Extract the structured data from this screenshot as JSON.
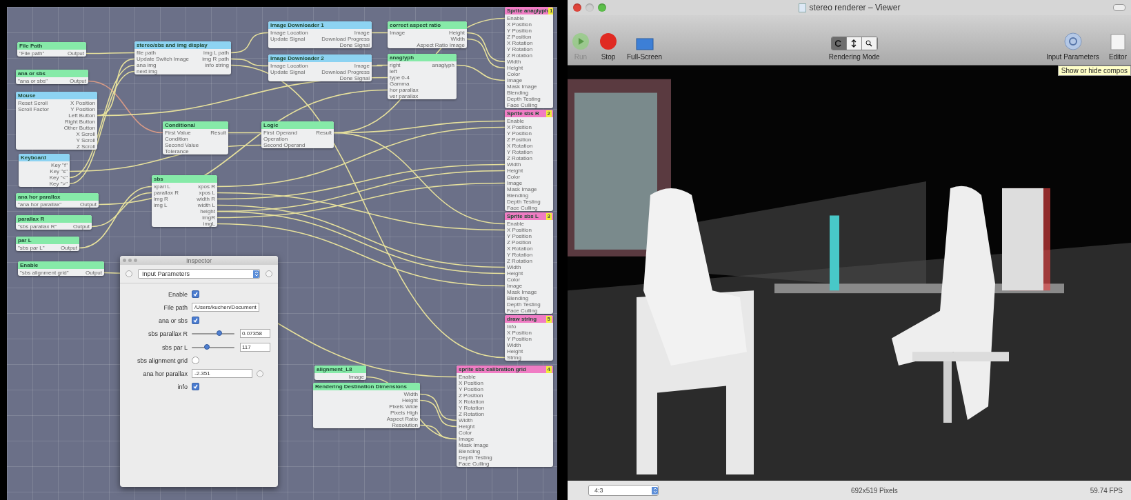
{
  "editor": {
    "nodes": [
      {
        "title": "File Path",
        "kind": "processor",
        "inputs": [
          "\"File path\""
        ],
        "outputs": [
          "Output"
        ]
      },
      {
        "title": "ana or sbs",
        "kind": "processor",
        "inputs": [
          "\"ana or sbs\""
        ],
        "outputs": [
          "Output"
        ]
      },
      {
        "title": "Mouse",
        "kind": "provider",
        "inputs": [
          "Reset Scroll",
          "Scroll Factor"
        ],
        "outputs": [
          "X Position",
          "Y Position",
          "Left Button",
          "Right Button",
          "Other Button",
          "X Scroll",
          "Y Scroll",
          "Z Scroll"
        ]
      },
      {
        "title": "Keyboard",
        "kind": "provider",
        "outputs": [
          "Key \"f\"",
          "Key \"s\"",
          "Key \"<\"",
          "Key \">\""
        ]
      },
      {
        "title": "ana hor parallax",
        "kind": "processor",
        "inputs": [
          "\"ana hor parallax\""
        ],
        "outputs": [
          "Output"
        ]
      },
      {
        "title": "parallax R",
        "kind": "processor",
        "inputs": [
          "\"sbs parallax R\""
        ],
        "outputs": [
          "Output"
        ]
      },
      {
        "title": "par L",
        "kind": "processor",
        "inputs": [
          "\"sbs par L\""
        ],
        "outputs": [
          "Output"
        ]
      },
      {
        "title": "Enable",
        "kind": "processor",
        "inputs": [
          "\"sbs alignment grid\""
        ],
        "outputs": [
          "Output"
        ]
      },
      {
        "title": "stereo/sbs and img display",
        "kind": "provider",
        "inputs": [
          "file path",
          "Update Switch Image",
          "ana img",
          "next img"
        ],
        "outputs": [
          "img L path",
          "img R path",
          "info string"
        ]
      },
      {
        "title": "Image Downloader 1",
        "kind": "provider",
        "inputs": [
          "Image Location",
          "Update Signal"
        ],
        "outputs": [
          "Image",
          "Download Progress",
          "Done Signal"
        ]
      },
      {
        "title": "Image Downloader 2",
        "kind": "provider",
        "inputs": [
          "Image Location",
          "Update Signal"
        ],
        "outputs": [
          "Image",
          "Download Progress",
          "Done Signal"
        ]
      },
      {
        "title": "correct aspect ratio",
        "kind": "processor",
        "inputs": [
          "Image"
        ],
        "outputs": [
          "Height",
          "Width",
          "Aspect Ratio Image"
        ]
      },
      {
        "title": "anaglyph",
        "kind": "processor",
        "inputs": [
          "right",
          "left",
          "type 0-4",
          "Gamma",
          "hor parallax",
          "ver parallax"
        ],
        "outputs": [
          "anaglyph"
        ]
      },
      {
        "title": "Conditional",
        "kind": "processor",
        "inputs": [
          "First Value",
          "Condition",
          "Second Value",
          "Tolerance"
        ],
        "outputs": [
          "Result"
        ]
      },
      {
        "title": "Logic",
        "kind": "processor",
        "inputs": [
          "First Operand",
          "Operation",
          "Second Operand"
        ],
        "outputs": [
          "Result"
        ]
      },
      {
        "title": "sbs",
        "kind": "processor",
        "inputs": [
          "xpari L",
          "parallax R",
          "img R",
          "img L"
        ],
        "outputs": [
          "xpos R",
          "xpos L",
          "width R",
          "width L",
          "height",
          "imgR",
          "imgL"
        ]
      },
      {
        "title": "Sprite anaglyph",
        "kind": "consumer",
        "badge": "1",
        "inputs": [
          "Enable",
          "X Position",
          "Y Position",
          "Z Position",
          "X Rotation",
          "Y Rotation",
          "Z Rotation",
          "Width",
          "Height",
          "Color",
          "Image",
          "Mask Image",
          "Blending",
          "Depth Testing",
          "Face Culling"
        ]
      },
      {
        "title": "Sprite sbs R",
        "kind": "consumer",
        "badge": "2",
        "inputs": [
          "Enable",
          "X Position",
          "Y Position",
          "Z Position",
          "X Rotation",
          "Y Rotation",
          "Z Rotation",
          "Width",
          "Height",
          "Color",
          "Image",
          "Mask Image",
          "Blending",
          "Depth Testing",
          "Face Culling"
        ]
      },
      {
        "title": "Sprite sbs L",
        "kind": "consumer",
        "badge": "3",
        "inputs": [
          "Enable",
          "X Position",
          "Y Position",
          "Z Position",
          "X Rotation",
          "Y Rotation",
          "Z Rotation",
          "Width",
          "Height",
          "Color",
          "Image",
          "Mask Image",
          "Blending",
          "Depth Testing",
          "Face Culling"
        ]
      },
      {
        "title": "draw string",
        "kind": "consumer",
        "badge": "5",
        "inputs": [
          "Info",
          "X Position",
          "Y Position",
          "Width",
          "Height",
          "String"
        ]
      },
      {
        "title": "alignment_L8",
        "kind": "processor",
        "outputs": [
          "Image"
        ]
      },
      {
        "title": "Rendering Destination Dimensions",
        "kind": "processor",
        "outputs": [
          "Width",
          "Height",
          "Pixels Wide",
          "Pixels High",
          "Aspect Ratio",
          "Resolution"
        ]
      },
      {
        "title": "sprite sbs calibration grid",
        "kind": "consumer",
        "badge": "4",
        "inputs": [
          "Enable",
          "X Position",
          "Y Position",
          "Z Position",
          "X Rotation",
          "Y Rotation",
          "Z Rotation",
          "Width",
          "Height",
          "Color",
          "Image",
          "Mask Image",
          "Blending",
          "Depth Testing",
          "Face Culling"
        ]
      }
    ]
  },
  "inspector": {
    "title": "Inspector",
    "mode": "Input Parameters",
    "params": [
      {
        "kind": "checkbox",
        "label": "Enable",
        "checked": true
      },
      {
        "kind": "text",
        "label": "File path",
        "value": "/Users/kuchen/Document"
      },
      {
        "kind": "checkbox",
        "label": "ana or sbs",
        "checked": true
      },
      {
        "kind": "slider",
        "label": "sbs parallax R",
        "level": 0.65,
        "value": "0.07358"
      },
      {
        "kind": "slider",
        "label": "sbs par L",
        "level": 0.35,
        "value": "117"
      },
      {
        "kind": "checkbox",
        "label": "sbs alignment grid",
        "checked": false
      },
      {
        "kind": "stepper",
        "label": "ana hor parallax",
        "value": "-2.351"
      },
      {
        "kind": "checkbox",
        "label": "info",
        "checked": true
      }
    ]
  },
  "viewer": {
    "title": "stereo renderer – Viewer",
    "toolbar": [
      {
        "kind": "run",
        "label": "Run",
        "disabled": true
      },
      {
        "kind": "stop",
        "label": "Stop",
        "disabled": false
      },
      {
        "kind": "fullscreen",
        "label": "Full-Screen",
        "disabled": false
      }
    ],
    "rendering_mode": {
      "label": "Rendering Mode",
      "segments": [
        {
          "kind": "pointer",
          "selected": true
        },
        {
          "kind": "move",
          "selected": false
        },
        {
          "kind": "zoom",
          "selected": false
        }
      ]
    },
    "toolbar_right": [
      {
        "kind": "parameters",
        "label": "Input Parameters",
        "disabled": false
      },
      {
        "kind": "editor",
        "label": "Editor",
        "disabled": false
      }
    ],
    "tooltip": "Show or hide compos",
    "status_bar": {
      "aspect": "4:3",
      "size": "692x519 Pixels",
      "fps": "59.74 FPS"
    }
  }
}
